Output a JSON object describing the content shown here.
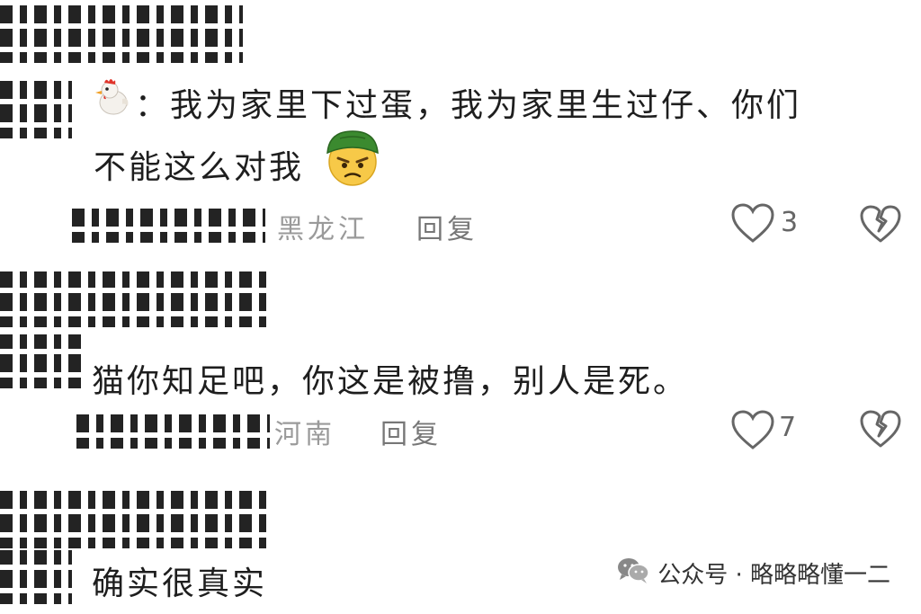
{
  "comments": [
    {
      "line1": "：我为家里下过蛋，我为家里生过仔、你们",
      "line2": "不能这么对我",
      "location": "黑龙江",
      "reply_label": "回复",
      "likes": "3"
    },
    {
      "line1": "猫你知足吧，你这是被撸，别人是死。",
      "location": "河南",
      "reply_label": "回复",
      "likes": "7"
    },
    {
      "line1": "确实很真实"
    }
  ],
  "watermark": {
    "text": "公众号 · 略略略懂一二",
    "icon": "wechat-icon"
  },
  "icons": {
    "chicken": "chicken-emoji-icon",
    "angry": "angry-face-green-hat-emoji-icon",
    "like": "heart-outline-icon",
    "dislike": "broken-heart-icon"
  }
}
